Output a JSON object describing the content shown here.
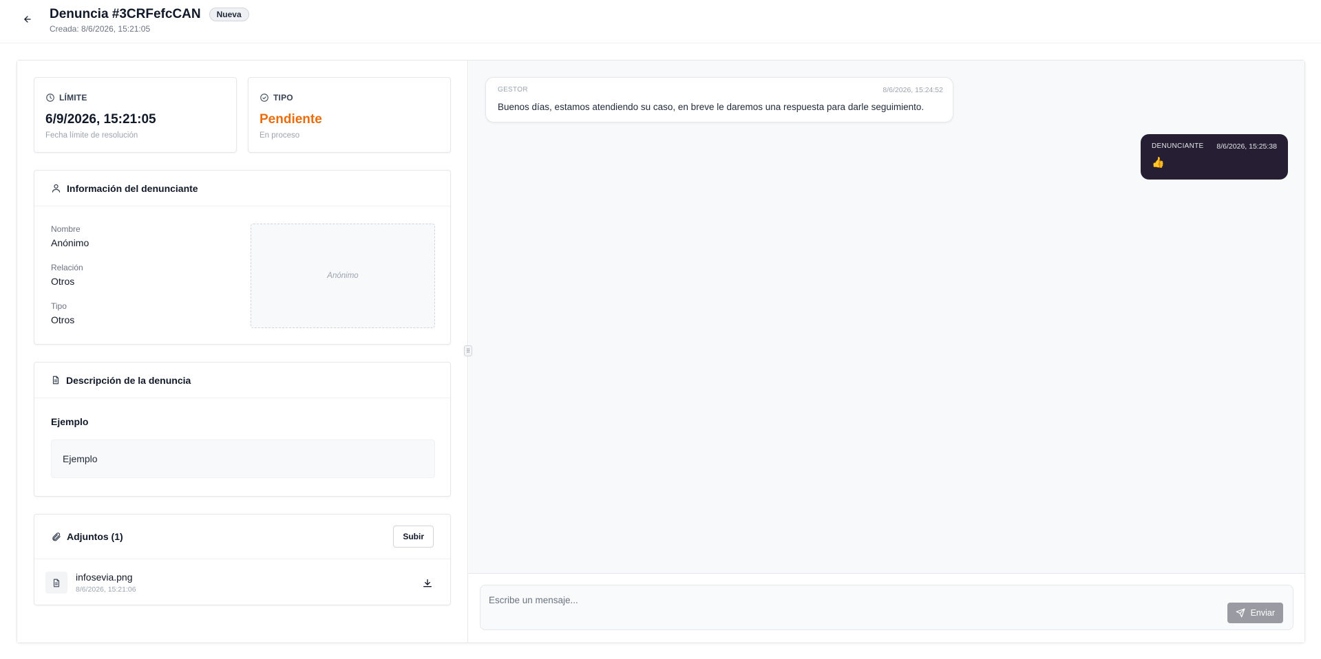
{
  "header": {
    "title": "Denuncia #3CRFefcCAN",
    "status_badge": "Nueva",
    "created": "Creada: 8/6/2026, 15:21:05"
  },
  "stats": {
    "limit": {
      "label": "LÍMITE",
      "value": "6/9/2026, 15:21:05",
      "sub": "Fecha límite de resolución"
    },
    "type": {
      "label": "TIPO",
      "value": "Pendiente",
      "sub": "En proceso",
      "value_color": "#ea6c0a"
    }
  },
  "reporter": {
    "title": "Información del denunciante",
    "fields": [
      {
        "label": "Nombre",
        "value": "Anónimo"
      },
      {
        "label": "Relación",
        "value": "Otros"
      },
      {
        "label": "Tipo",
        "value": "Otros"
      }
    ],
    "avatar_placeholder": "Anónimo"
  },
  "description": {
    "title": "Descripción de la denuncia",
    "subject": "Ejemplo",
    "body": "Ejemplo"
  },
  "attachments": {
    "title": "Adjuntos (1)",
    "upload_label": "Subir",
    "files": [
      {
        "name": "infosevia.png",
        "date": "8/6/2026, 15:21:06"
      }
    ]
  },
  "chat": {
    "messages": [
      {
        "author": "GESTOR",
        "time": "8/6/2026, 15:24:52",
        "text": "Buenos días, estamos atendiendo su caso, en breve le daremos una respuesta para darle seguimiento."
      },
      {
        "author": "DENUNCIANTE",
        "time": "8/6/2026, 15:25:38",
        "text": "👍"
      }
    ],
    "input_placeholder": "Escribe un mensaje...",
    "send_label": "Enviar"
  },
  "icons": {
    "back": "arrow-left-icon",
    "limit": "clock-icon",
    "type": "check-circle-icon",
    "reporter": "user-icon",
    "description": "document-icon",
    "attachments": "paperclip-icon",
    "file": "file-icon",
    "download": "download-icon",
    "send": "send-icon",
    "resize": "grip-icon"
  }
}
